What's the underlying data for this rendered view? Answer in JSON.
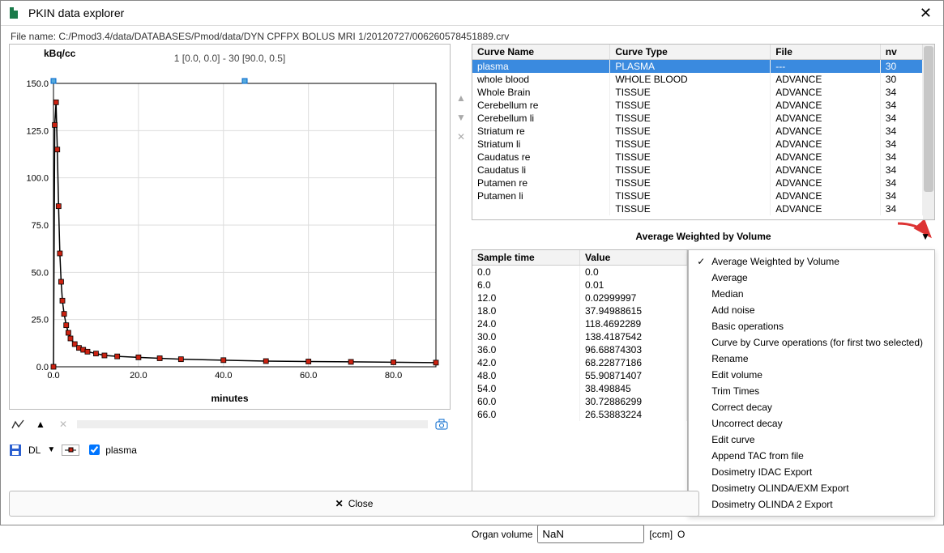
{
  "window": {
    "title": "PKIN data explorer"
  },
  "filebar": {
    "label": "File name:",
    "value": "C:/Pmod3.4/data/DATABASES/Pmod/data/DYN  CPFPX BOLUS   MRI 1/20120727/006260578451889.crv"
  },
  "plot": {
    "yTitle": "kBq/cc",
    "subtitle": "1 [0.0, 0.0] - 30 [90.0, 0.5]",
    "xTitle": "minutes",
    "xTicks": [
      "0.0",
      "20.0",
      "40.0",
      "60.0",
      "80.0"
    ],
    "yTicks": [
      "0.0",
      "25.0",
      "50.0",
      "75.0",
      "100.0",
      "125.0",
      "150.0"
    ]
  },
  "chart_data": {
    "type": "line",
    "title": "plasma",
    "xlabel": "minutes",
    "ylabel": "kBq/cc",
    "xlim": [
      0,
      90
    ],
    "ylim": [
      0,
      150
    ],
    "series": [
      {
        "name": "plasma",
        "x": [
          0,
          0.3,
          0.6,
          0.9,
          1.2,
          1.5,
          1.8,
          2.1,
          2.5,
          3,
          3.5,
          4,
          5,
          6,
          7,
          8,
          10,
          12,
          15,
          20,
          25,
          30,
          40,
          50,
          60,
          70,
          80,
          90
        ],
        "y": [
          0,
          128,
          140,
          115,
          85,
          60,
          45,
          35,
          28,
          22,
          18,
          15,
          12,
          10,
          9,
          8,
          7,
          6,
          5.5,
          5,
          4.5,
          4,
          3.5,
          3,
          2.8,
          2.6,
          2.4,
          2.2
        ]
      }
    ]
  },
  "legend": {
    "dl": "DL",
    "plasmaLabel": "plasma"
  },
  "curves": {
    "headers": [
      "Curve Name",
      "Curve Type",
      "File",
      "nv"
    ],
    "rows": [
      [
        "plasma",
        "PLASMA",
        "---",
        "30"
      ],
      [
        "whole blood",
        "WHOLE BLOOD",
        "ADVANCE",
        "30"
      ],
      [
        "Whole Brain",
        "TISSUE",
        "ADVANCE",
        "34"
      ],
      [
        "Cerebellum re",
        "TISSUE",
        "ADVANCE",
        "34"
      ],
      [
        "Cerebellum li",
        "TISSUE",
        "ADVANCE",
        "34"
      ],
      [
        "Striatum re",
        "TISSUE",
        "ADVANCE",
        "34"
      ],
      [
        "Striatum li",
        "TISSUE",
        "ADVANCE",
        "34"
      ],
      [
        "Caudatus re",
        "TISSUE",
        "ADVANCE",
        "34"
      ],
      [
        "Caudatus li",
        "TISSUE",
        "ADVANCE",
        "34"
      ],
      [
        "Putamen re",
        "TISSUE",
        "ADVANCE",
        "34"
      ],
      [
        "Putamen li",
        "TISSUE",
        "ADVANCE",
        "34"
      ],
      [
        "",
        "TISSUE",
        "ADVANCE",
        "34"
      ]
    ],
    "selected": 0
  },
  "avgLabel": "Average Weighted by Volume",
  "values": {
    "headers": [
      "Sample time",
      "Value"
    ],
    "rows": [
      [
        "0.0",
        "0.0"
      ],
      [
        "6.0",
        "0.01"
      ],
      [
        "12.0",
        "0.02999997"
      ],
      [
        "18.0",
        "37.94988615"
      ],
      [
        "24.0",
        "118.4692289"
      ],
      [
        "30.0",
        "138.4187542"
      ],
      [
        "36.0",
        "96.68874303"
      ],
      [
        "42.0",
        "68.22877186"
      ],
      [
        "48.0",
        "55.90871407"
      ],
      [
        "54.0",
        "38.498845"
      ],
      [
        "60.0",
        "30.72886299"
      ],
      [
        "66.0",
        "26.53883224"
      ]
    ]
  },
  "menu": {
    "items": [
      "Average Weighted by Volume",
      "Average",
      "Median",
      "Add noise",
      "Basic operations",
      "Curve by Curve operations (for first two selected)",
      "Rename",
      "Edit volume",
      "Trim Times",
      "Correct decay",
      "Uncorrect decay",
      "Edit curve",
      "Append TAC from file",
      "Dosimetry IDAC Export",
      "Dosimetry OLINDA/EXM Export",
      "Dosimetry OLINDA 2 Export"
    ],
    "checked": 0
  },
  "organ": {
    "label": "Organ volume",
    "value": "NaN",
    "unit": "[ccm]",
    "trail": "O"
  },
  "closeLabel": "Close"
}
